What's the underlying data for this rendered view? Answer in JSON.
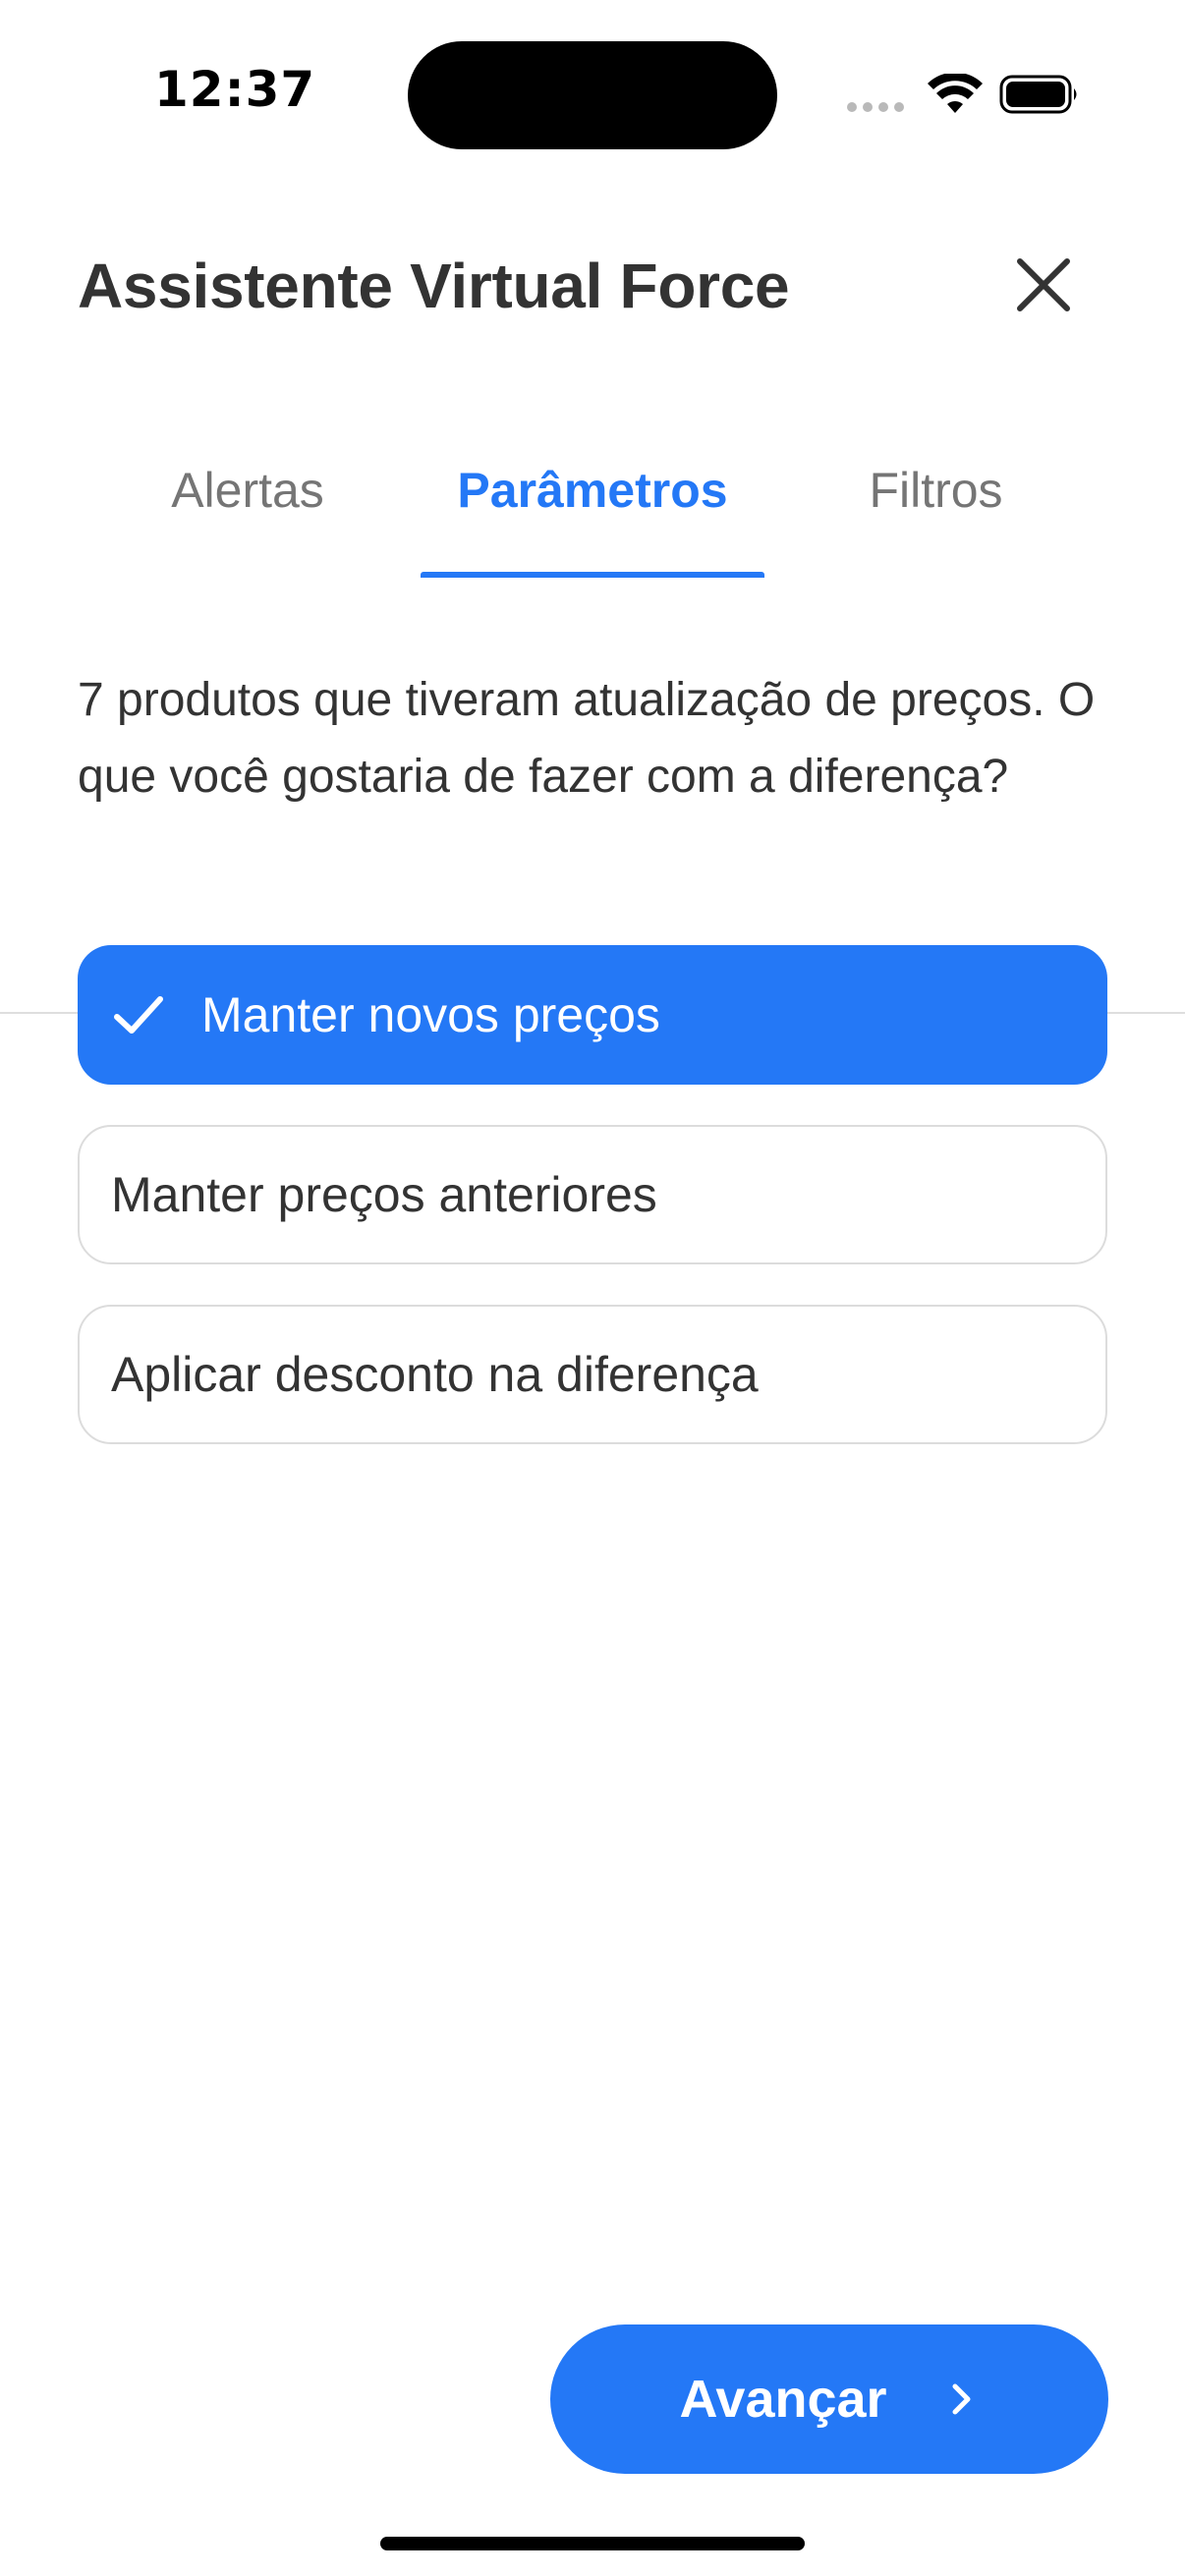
{
  "status_bar": {
    "time": "12:37",
    "icons": [
      "cellular-signal-icon",
      "wifi-icon",
      "battery-icon"
    ]
  },
  "header": {
    "title": "Assistente Virtual Force",
    "close_icon": "close-icon"
  },
  "tabs": [
    {
      "label": "Alertas",
      "active": false
    },
    {
      "label": "Parâmetros",
      "active": true
    },
    {
      "label": "Filtros",
      "active": false
    }
  ],
  "content": {
    "question": "7 produtos que tiveram atualização de preços. O que você gostaria de fazer com a diferença?",
    "options": [
      {
        "label": "Manter novos preços",
        "selected": true
      },
      {
        "label": "Manter preços anteriores",
        "selected": false
      },
      {
        "label": "Aplicar desconto na diferença",
        "selected": false
      }
    ]
  },
  "footer": {
    "next_label": "Avançar",
    "next_icon": "chevron-right-icon"
  },
  "colors": {
    "accent": "#2478f6",
    "text": "#333333",
    "muted": "#757575",
    "border": "#dcdcdc",
    "background": "#ffffff"
  }
}
